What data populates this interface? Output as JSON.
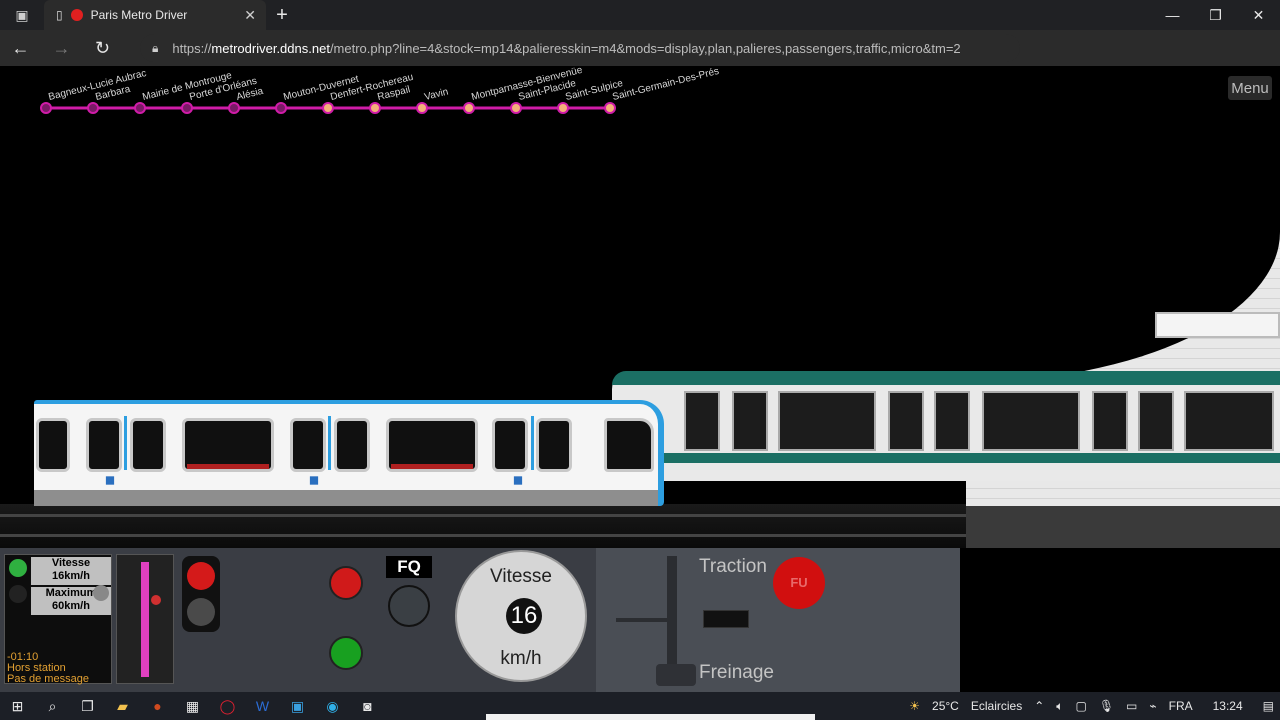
{
  "browser": {
    "tab_title": "Paris Metro Driver",
    "url_prefix": "https://",
    "url_host": "metrodriver.ddns.net",
    "url_path": "/metro.php?line=4&stock=mp14&palieresskin=m4&mods=display,plan,palieres,passengers,traffic,micro&tm=2"
  },
  "game": {
    "menu_label": "Menu",
    "line_color": "#d01ca8",
    "stations": [
      {
        "name": "Bagneux-Lucie Aubrac",
        "state": "passed"
      },
      {
        "name": "Barbara",
        "state": "passed"
      },
      {
        "name": "Mairie de Montrouge",
        "state": "passed"
      },
      {
        "name": "Porte d'Orléans",
        "state": "passed"
      },
      {
        "name": "Alésia",
        "state": "passed"
      },
      {
        "name": "Mouton-Duvernet",
        "state": "passed"
      },
      {
        "name": "Denfert-Rochereau",
        "state": "next"
      },
      {
        "name": "Raspail",
        "state": "next"
      },
      {
        "name": "Vavin",
        "state": "next"
      },
      {
        "name": "Montparnasse-Bienvenüe",
        "state": "next"
      },
      {
        "name": "Saint-Placide",
        "state": "next"
      },
      {
        "name": "Saint-Sulpice",
        "state": "next"
      },
      {
        "name": "Saint-Germain-Des-Prés",
        "state": "next"
      }
    ]
  },
  "panel": {
    "speed_badge_line1": "Vitesse",
    "speed_badge_line2": "16km/h",
    "max_badge_line1": "Maximum",
    "max_badge_line2": "60km/h",
    "timer": "-01:10",
    "location_status": "Hors station",
    "message_status": "Pas de message",
    "fq_label": "FQ",
    "speedo_label": "Vitesse",
    "speedo_value": "16",
    "speedo_unit": "km/h",
    "traction_label": "Traction",
    "braking_label": "Freinage",
    "fu_label": "FU",
    "throttle_level": 0.0,
    "speed_bar_fraction": 0.27
  },
  "taskbar": {
    "weather_temp": "25°C",
    "weather_text": "Eclaircies",
    "language": "FRA",
    "time": "13:24"
  }
}
